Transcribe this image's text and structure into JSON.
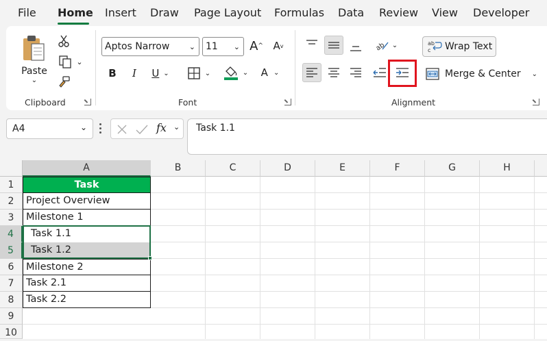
{
  "menu": {
    "tabs": [
      "File",
      "Home",
      "Insert",
      "Draw",
      "Page Layout",
      "Formulas",
      "Data",
      "Review",
      "View",
      "Developer"
    ],
    "active": "Home"
  },
  "ribbon": {
    "clipboard": {
      "paste_label": "Paste",
      "group_label": "Clipboard"
    },
    "font": {
      "font_name": "Aptos Narrow",
      "font_size": "11",
      "group_label": "Font",
      "bold": "B",
      "italic": "I",
      "underline": "U",
      "grow": "A",
      "shrink": "A",
      "font_color": "A"
    },
    "alignment": {
      "wrap_text": "Wrap Text",
      "merge_center": "Merge & Center",
      "group_label": "Alignment"
    }
  },
  "formula_bar": {
    "name_box": "A4",
    "fx": "fx",
    "content": "Task 1.1"
  },
  "sheet": {
    "columns": [
      "A",
      "B",
      "C",
      "D",
      "E",
      "F",
      "G",
      "H"
    ],
    "rows": [
      "1",
      "2",
      "3",
      "4",
      "5",
      "6",
      "7",
      "8",
      "9",
      "10"
    ],
    "header_cell": "Task",
    "cells": [
      "Project Overview",
      "Milestone 1",
      "Task 1.1",
      "Task 1.2",
      "Milestone 2",
      "Task 2.1",
      "Task 2.2"
    ]
  },
  "colors": {
    "accent": "#0f7b3f",
    "header_fill": "#00b050",
    "highlight": "#e0141e",
    "selection": "#d3d3d3"
  }
}
